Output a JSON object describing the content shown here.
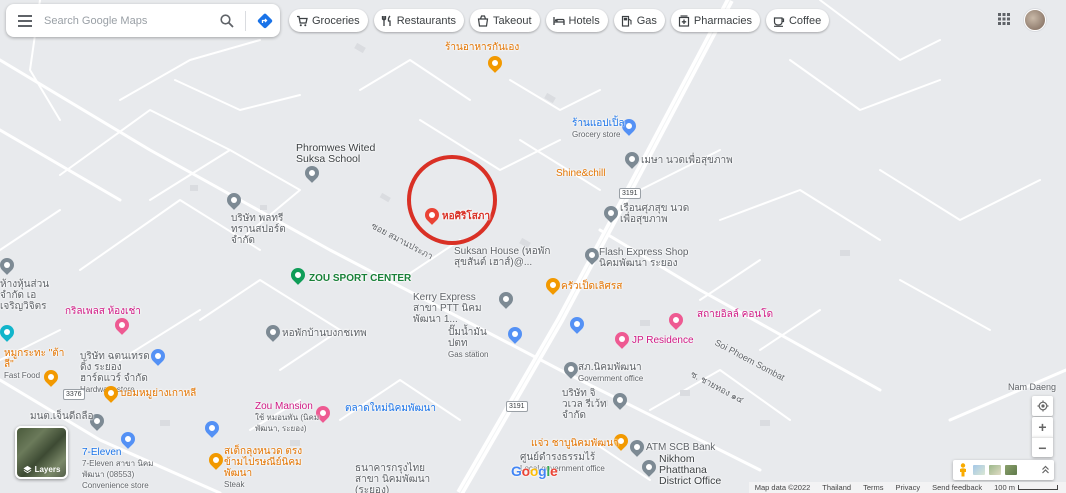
{
  "search": {
    "placeholder": "Search Google Maps",
    "menu_icon": "hamburger-icon",
    "search_icon": "magnifier-icon",
    "directions_icon": "directions-icon"
  },
  "chips": [
    {
      "label": "Groceries",
      "icon": "cart-icon"
    },
    {
      "label": "Restaurants",
      "icon": "fork-knife-icon"
    },
    {
      "label": "Takeout",
      "icon": "takeout-icon"
    },
    {
      "label": "Hotels",
      "icon": "bed-icon"
    },
    {
      "label": "Gas",
      "icon": "gas-pump-icon"
    },
    {
      "label": "Pharmacies",
      "icon": "pharmacy-icon"
    },
    {
      "label": "Coffee",
      "icon": "coffee-icon"
    }
  ],
  "header": {
    "apps_icon": "apps-grid-icon",
    "avatar": "account-avatar"
  },
  "highlight": {
    "label": "หอศิริโสภา",
    "color": "#d93025"
  },
  "places": {
    "restaurant_top": "ร้านอาหารกันเอง",
    "grocery": {
      "name": "ร้านแอปเปิ้ล",
      "sub": "Grocery store"
    },
    "phromwes": "Phromwes Wited Suksa School",
    "massage1": "เมษา นวดเพื่อสุขภาพ",
    "shine": "Shine&chill",
    "company1": "บริษัท พลทรี ทรานสปอร์ต จำกัด",
    "massage2": "เรือนศุภสุข นวดเพื่อสุขภาพ",
    "flash": "Flash Express Shop นิคมพัฒนา ระยอง",
    "suksan": "Suksan House (หอพัก สุขสันต์ เฮาส์)@...",
    "zou_sport": "ZOU SPORT CENTER",
    "kitchen": "ครัวเป็ดเลิศรส",
    "kerry": "Kerry Express สาขา PTT นิคมพัฒนา 1...",
    "cooperative": "ห้างหุ้นส่วนจำกัด เอเจริญวิจิตร",
    "grill": "กริลเพลส ห้องเช่า",
    "dorm_bangkok": "หอพักบ้านบงกชเทพ",
    "gas_station": {
      "name": "ปั๊มน้ำมัน ปตท",
      "sub": "Gas station"
    },
    "sathaya": "สถายอิลล์ คอนโด",
    "jp_residence": "JP Residence",
    "kfc": {
      "name": "หมูกระทะ \"ต้าลี\"",
      "sub": "Fast Food"
    },
    "hardware": {
      "name": "บริษัท ฉตนเทรดดิ้ง ระยอง ฮาร์ดแวร์ จำกัด",
      "sub": "Hardware store"
    },
    "gov_office": {
      "name": "สภ.นิคมพัฒนา",
      "sub": "Government office"
    },
    "restaurant_left": "บอมหมูย่างเกาหลี",
    "company_right": "บริษัท จิวเวล รีเว้ท จำกัด",
    "zou_mansion": {
      "name": "Zou Mansion",
      "sub": "ใช้ หมอนพัน (นิคม พัฒนา, ระยอง)"
    },
    "market": "ตลาดใหม่นิคมพัฒนา",
    "mon_left": "มนต.เจ็นดีถลือ",
    "seven_eleven": {
      "name": "7-Eleven",
      "sub": "7-Eleven สาขา นิคมพัฒนา (08553) Convenience store"
    },
    "steak": {
      "name": "สเต็กลุงหนวด ตรง ข้ามไปรษณีย์นิคมพัฒนา",
      "sub": "Steak"
    },
    "noodle": "แจ่ว ชาบูนิคมพัฒนา",
    "gov_center": {
      "name": "ศูนย์ดำรงธรรมไร้",
      "sub": "Local government office"
    },
    "atm": "ATM SCB Bank",
    "district": "Nikhom Phatthana District Office",
    "bank": "ธนาคารกรุงไทย สาขา นิคมพัฒนา (ระยอง)"
  },
  "roads": {
    "soi_samanprapha": "ซอย สมานประภา",
    "soi_phoem": "Soi Phoem Sombat",
    "soi_right": "ซ. ชายทอง ๑๔",
    "nam_daeng": "Nam Daeng",
    "route_shield": "3191",
    "route_shield2": "3376"
  },
  "layers": {
    "label": "Layers",
    "icon": "layers-icon"
  },
  "controls": {
    "locate_icon": "my-location-icon",
    "zoom_in": "+",
    "zoom_out": "−",
    "pegman_icon": "pegman-icon",
    "expand_icon": "expand-icon"
  },
  "logo": "Google",
  "footer": {
    "map_data": "Map data ©2022",
    "country": "Thailand",
    "terms": "Terms",
    "privacy": "Privacy",
    "feedback": "Send feedback",
    "scale": "100 m"
  }
}
